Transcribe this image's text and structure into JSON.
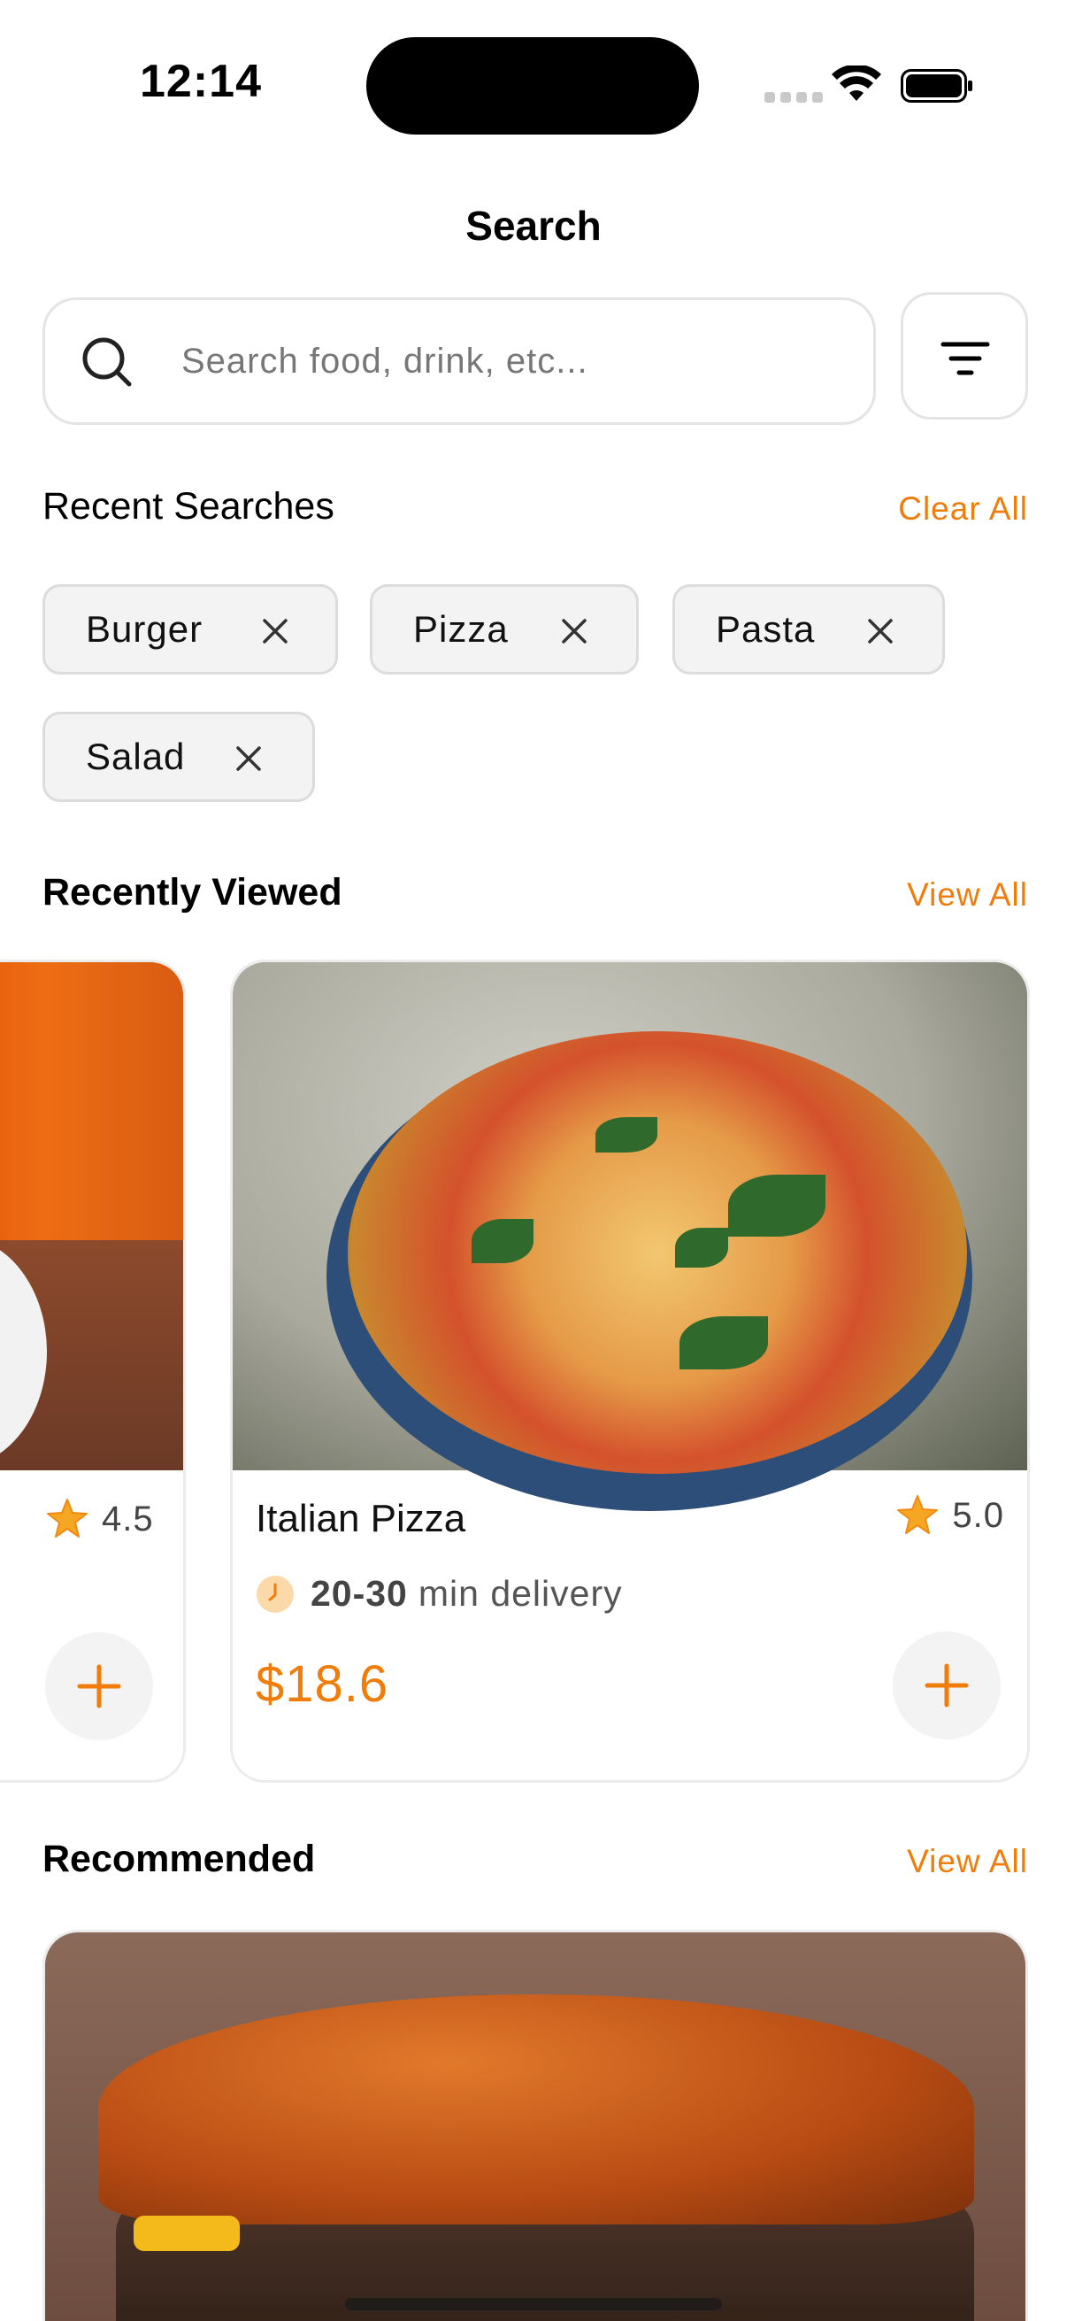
{
  "status_bar": {
    "time": "12:14"
  },
  "header": {
    "title": "Search"
  },
  "search": {
    "placeholder": "Search food, drink, etc..."
  },
  "recent_searches": {
    "title": "Recent Searches",
    "clear_label": "Clear All",
    "chips": [
      "Burger",
      "Pizza",
      "Pasta",
      "Salad"
    ]
  },
  "recently_viewed": {
    "title": "Recently Viewed",
    "view_all_label": "View All",
    "items": [
      {
        "rating": "4.5"
      },
      {
        "name": "Italian Pizza",
        "rating": "5.0",
        "delivery_time": "20-30",
        "delivery_suffix": "min delivery",
        "price": "$18.6"
      }
    ]
  },
  "recommended": {
    "title": "Recommended",
    "view_all_label": "View All"
  },
  "colors": {
    "accent": "#f07c0a",
    "chip_bg": "#f3f3f3",
    "border": "#e4e4e4"
  },
  "icons": [
    "search-icon",
    "filter-icon",
    "close-icon",
    "star-icon",
    "clock-icon",
    "plus-icon",
    "wifi-icon",
    "battery-icon"
  ]
}
